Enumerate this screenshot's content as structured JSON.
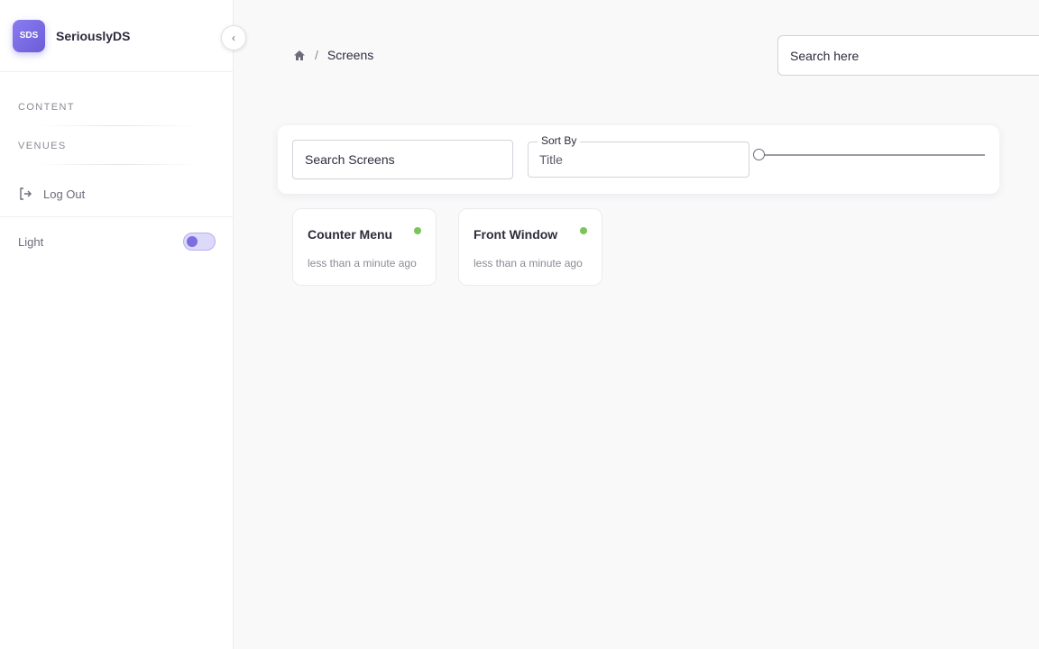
{
  "brand": {
    "logo_text": "SDS",
    "name": "SeriouslyDS"
  },
  "sidebar": {
    "sections": [
      {
        "label": "CONTENT"
      },
      {
        "label": "VENUES"
      }
    ],
    "logout_label": "Log Out",
    "theme_label": "Light",
    "theme_toggle_on": false
  },
  "breadcrumb": {
    "current": "Screens"
  },
  "header": {
    "search_placeholder": "Search here"
  },
  "filters": {
    "search_placeholder": "Search Screens",
    "sort_label": "Sort By",
    "sort_value": "Title",
    "slider_value": 0
  },
  "screens": [
    {
      "title": "Counter Menu",
      "updated": "less than a minute ago",
      "status_color": "#7ac55a"
    },
    {
      "title": "Front Window",
      "updated": "less than a minute ago",
      "status_color": "#7ac55a"
    }
  ],
  "colors": {
    "accent": "#7b6fe0",
    "online": "#7ac55a"
  }
}
